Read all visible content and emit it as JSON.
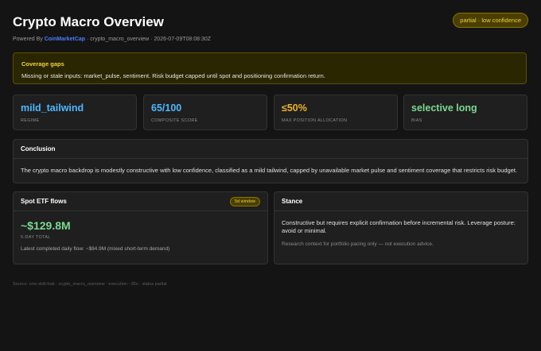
{
  "header": {
    "title": "Crypto Macro Overview",
    "badge": "partial · low confidence",
    "subtitle_prefix": "Powered By",
    "brand": "CoinMarketCap",
    "subtitle_suffix": " · crypto_macro_overview · 2026-07-09T08:08:30Z"
  },
  "coverage_gaps": {
    "title": "Coverage gaps",
    "text": "Missing or stale inputs: market_pulse, sentiment. Risk budget capped until spot and positioning confirmation return."
  },
  "metrics": [
    {
      "value": "mild_tailwind",
      "label": "REGIME",
      "color": "#4db8ff"
    },
    {
      "value": "65/100",
      "label": "COMPOSITE SCORE",
      "color": "#4db8ff"
    },
    {
      "value": "≤50%",
      "label": "MAX POSITION ALLOCATION",
      "color": "#f0b429"
    },
    {
      "value": "selective long",
      "label": "BIAS",
      "color": "#7bd88f"
    }
  ],
  "conclusion": {
    "title": "Conclusion",
    "text": "The crypto macro backdrop is modestly constructive with low confidence, classified as a mild tailwind, capped by unavailable market pulse and sentiment coverage that restricts risk budget."
  },
  "etf": {
    "title": "Spot ETF flows",
    "pill": "5d window",
    "value": "~$129.8M",
    "caption": "5-DAY TOTAL",
    "note": "Latest completed daily flow: ~$84.9M (mixed short-term demand)"
  },
  "stance": {
    "title": "Stance",
    "text": "Constructive but requires explicit confirmation before incremental risk. Leverage posture: avoid or minimal.",
    "note": "Research context for portfolio pacing only — not execution advice."
  },
  "footer": {
    "text": "Source: cmc-skill-hub · crypto_macro_overview · execution ~35s · status partial"
  }
}
